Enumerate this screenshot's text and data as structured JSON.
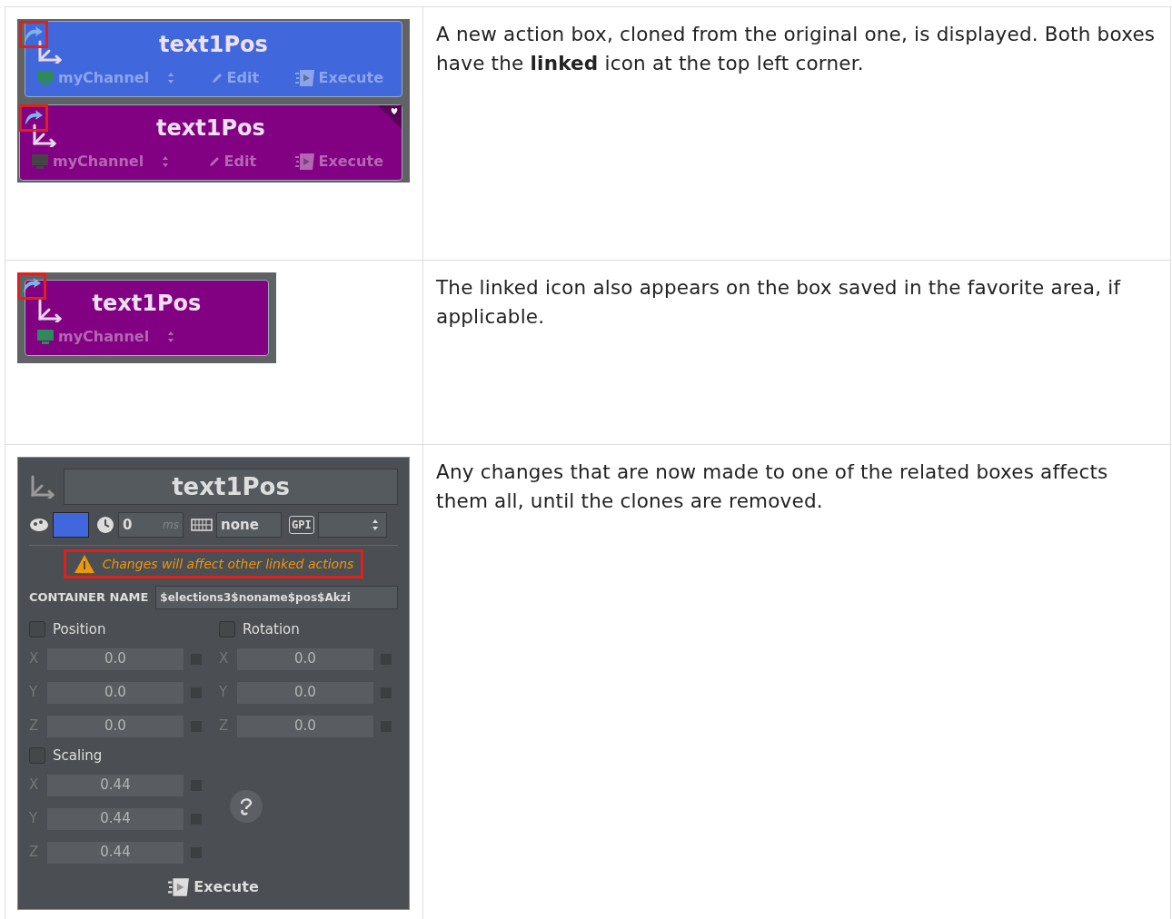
{
  "rows": [
    {
      "kind": "clone",
      "boxes": [
        {
          "title": "text1Pos",
          "channel": "myChannel",
          "edit": "Edit",
          "execute": "Execute",
          "color": "#4068dc",
          "favorite": false
        },
        {
          "title": "text1Pos",
          "channel": "myChannel",
          "edit": "Edit",
          "execute": "Execute",
          "color": "#820082",
          "favorite": true
        }
      ],
      "description": "A new action box, cloned from the original one, is displayed. Both boxes have the **linked** icon at the top left corner."
    },
    {
      "kind": "favorite",
      "box": {
        "title": "text1Pos",
        "channel": "myChannel",
        "color": "#820082"
      },
      "description": "The linked icon also appears on the box saved in the favorite area, if applicable."
    },
    {
      "kind": "editor",
      "editor": {
        "title": "text1Pos",
        "delay": "0",
        "delay_unit": "ms",
        "key": "none",
        "gpi": "GPI",
        "warning": "Changes will affect other linked actions",
        "container_label": "CONTAINER NAME",
        "container_value": "$elections3$noname$pos$Akzi",
        "groups": [
          {
            "label": "Position",
            "checked": false,
            "fields": [
              {
                "axis": "X",
                "value": "0.0",
                "locked": false
              },
              {
                "axis": "Y",
                "value": "0.0",
                "locked": false
              },
              {
                "axis": "Z",
                "value": "0.0",
                "locked": false
              }
            ]
          },
          {
            "label": "Rotation",
            "checked": false,
            "fields": [
              {
                "axis": "X",
                "value": "0.0",
                "locked": false
              },
              {
                "axis": "Y",
                "value": "0.0",
                "locked": false
              },
              {
                "axis": "Z",
                "value": "0.0",
                "locked": false
              }
            ]
          },
          {
            "label": "Scaling",
            "checked": false,
            "fields": [
              {
                "axis": "X",
                "value": "0.44",
                "locked": false
              },
              {
                "axis": "Y",
                "value": "0.44",
                "locked": false
              },
              {
                "axis": "Z",
                "value": "0.44",
                "locked": false
              }
            ]
          }
        ],
        "execute": "Execute"
      },
      "description": "Any changes that are now made to one of the related boxes affects them all, until the clones are removed."
    }
  ]
}
